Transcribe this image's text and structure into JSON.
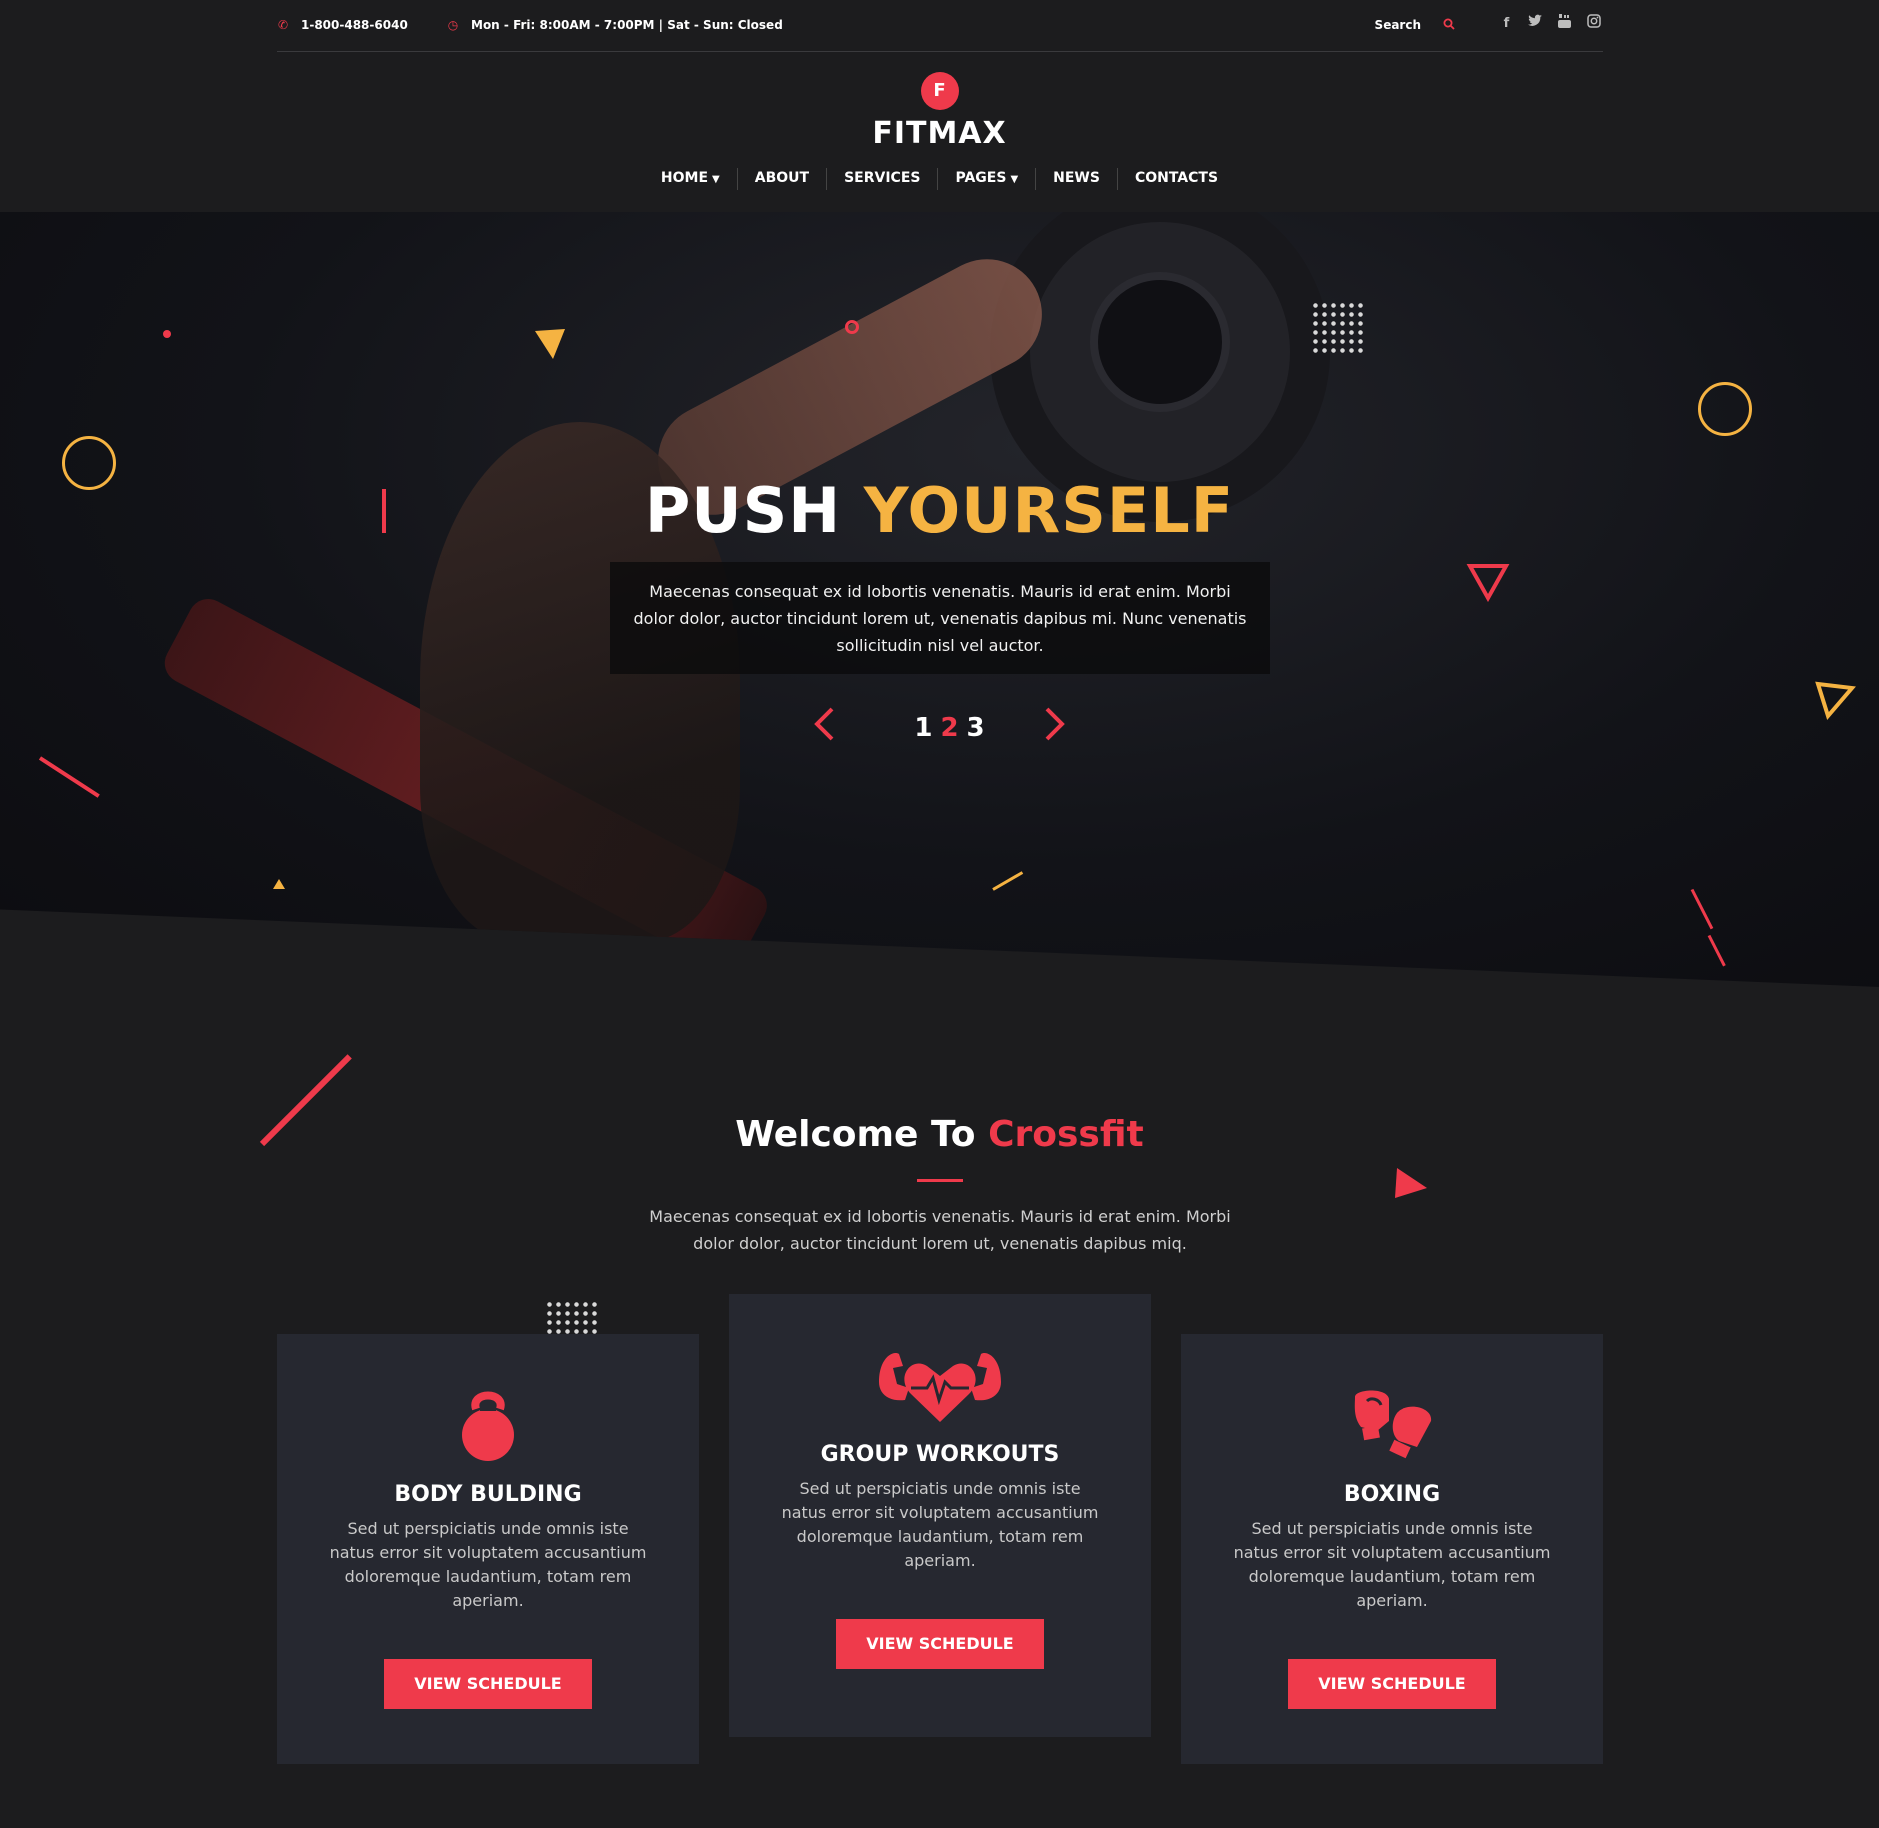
{
  "topbar": {
    "phone": "1-800-488-6040",
    "hours": "Mon - Fri: 8:00AM - 7:00PM | Sat - Sun: Closed",
    "search_label": "Search",
    "social": [
      "facebook-icon",
      "twitter-icon",
      "youtube-icon",
      "instagram-icon"
    ]
  },
  "logo": {
    "badge": "F",
    "name": "FITMAX"
  },
  "nav": {
    "items": [
      {
        "label": "HOME",
        "has_dropdown": true
      },
      {
        "label": "ABOUT",
        "has_dropdown": false
      },
      {
        "label": "SERVICES",
        "has_dropdown": false
      },
      {
        "label": "PAGES",
        "has_dropdown": true
      },
      {
        "label": "NEWS",
        "has_dropdown": false
      },
      {
        "label": "CONTACTS",
        "has_dropdown": false
      }
    ]
  },
  "hero": {
    "title_part1": "PUSH",
    "title_part2": "YOURSELF",
    "text": "Maecenas consequat ex id lobortis venenatis. Mauris id erat enim. Morbi dolor dolor, auctor tincidunt lorem ut, venenatis dapibus mi. Nunc venenatis sollicitudin nisl vel auctor.",
    "slides": [
      "1",
      "2",
      "3"
    ],
    "active_slide": "2",
    "prev_icon": "chevron-left-icon",
    "next_icon": "chevron-right-icon"
  },
  "welcome": {
    "title_part1": "Welcome To",
    "title_part2": "Crossfit",
    "text": "Maecenas consequat ex id lobortis venenatis. Mauris id erat enim. Morbi dolor dolor, auctor tincidunt lorem ut, venenatis dapibus miq."
  },
  "cards": [
    {
      "icon": "kettlebell-icon",
      "title": "BODY BULDING",
      "text": "Sed ut perspiciatis unde omnis iste natus error sit voluptatem accusantium doloremque laudantium, totam rem aperiam.",
      "button": "VIEW SCHEDULE"
    },
    {
      "icon": "heart-muscle-icon",
      "title": "GROUP WORKOUTS",
      "text": "Sed ut perspiciatis unde omnis iste natus error sit voluptatem accusantium doloremque laudantium, totam rem aperiam.",
      "button": "VIEW SCHEDULE"
    },
    {
      "icon": "boxing-gloves-icon",
      "title": "BOXING",
      "text": "Sed ut perspiciatis unde omnis iste natus error sit voluptatem accusantium doloremque laudantium, totam rem aperiam.",
      "button": "VIEW SCHEDULE"
    }
  ],
  "colors": {
    "accent_red": "#ef3a4b",
    "accent_yellow": "#f5b342",
    "background": "#1c1c1e",
    "card": "#262830"
  }
}
